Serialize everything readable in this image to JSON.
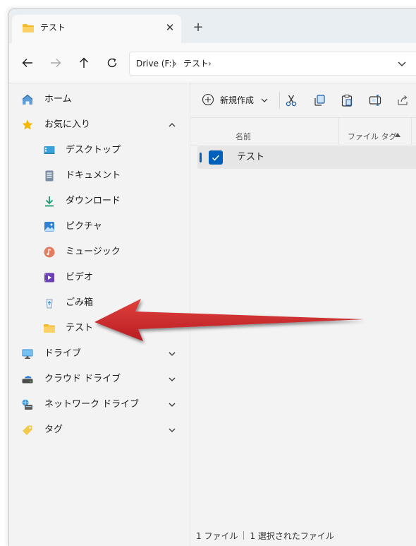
{
  "tab": {
    "title": "テスト",
    "close": "✕",
    "new_tab": "+"
  },
  "address": {
    "drive": "Drive (F:)",
    "folder": "テスト"
  },
  "sidebar": {
    "items": [
      {
        "label": "ホーム",
        "icon": "home-icon"
      },
      {
        "label": "お気に入り",
        "icon": "star-icon",
        "expanded": true
      },
      {
        "label": "デスクトップ",
        "icon": "desktop-icon"
      },
      {
        "label": "ドキュメント",
        "icon": "document-icon"
      },
      {
        "label": "ダウンロード",
        "icon": "download-icon"
      },
      {
        "label": "ピクチャ",
        "icon": "pictures-icon"
      },
      {
        "label": "ミュージック",
        "icon": "music-icon"
      },
      {
        "label": "ビデオ",
        "icon": "video-icon"
      },
      {
        "label": "ごみ箱",
        "icon": "recycle-bin-icon"
      },
      {
        "label": "テスト",
        "icon": "folder-icon"
      },
      {
        "label": "ドライブ",
        "icon": "monitor-icon"
      },
      {
        "label": "クラウド ドライブ",
        "icon": "cloud-drive-icon"
      },
      {
        "label": "ネットワーク ドライブ",
        "icon": "network-drive-icon"
      },
      {
        "label": "タグ",
        "icon": "tag-icon"
      }
    ]
  },
  "toolbar": {
    "new_label": "新規作成"
  },
  "columns": {
    "name": "名前",
    "file_tag": "ファイル タグ"
  },
  "files": [
    {
      "name": "テスト",
      "selected": true
    }
  ],
  "status": {
    "count": "1 ファイル",
    "selected": "1 選択されたファイル"
  },
  "colors": {
    "accent": "#005fb8",
    "arrow": "#c9262a",
    "folder": "#f8c94d"
  }
}
